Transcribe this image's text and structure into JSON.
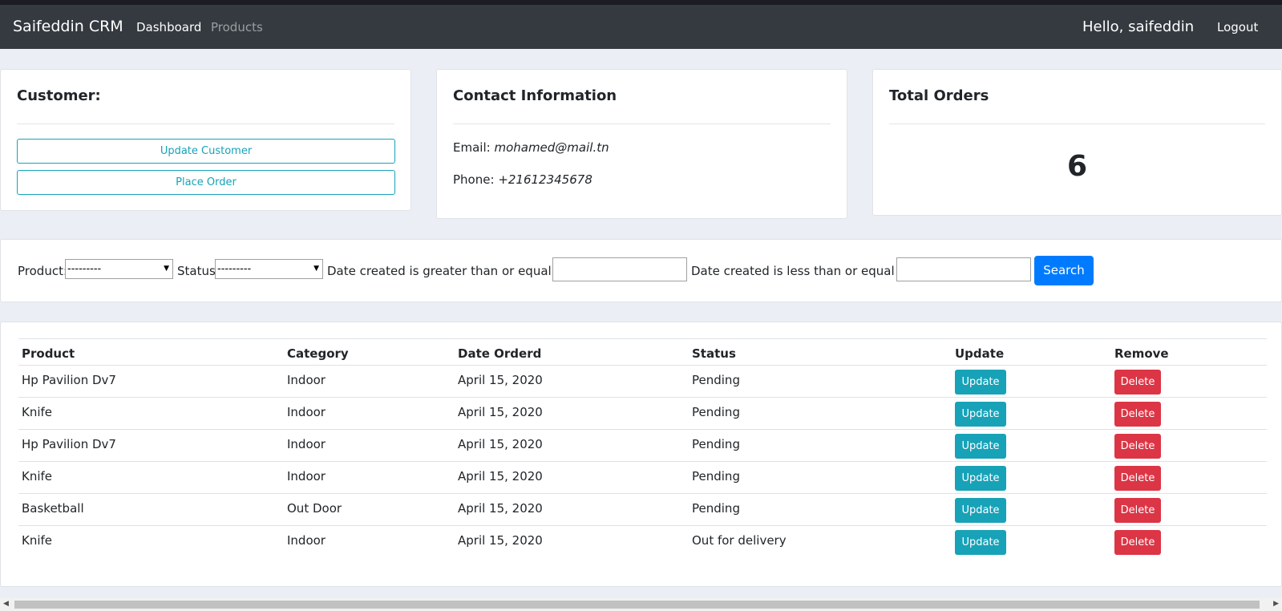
{
  "navbar": {
    "brand": "Saifeddin CRM",
    "links": [
      "Dashboard",
      "Products"
    ],
    "greeting": "Hello, saifeddin",
    "logout": "Logout"
  },
  "customer_card": {
    "title": "Customer:",
    "update_button": "Update Customer",
    "order_button": "Place Order"
  },
  "contact_card": {
    "title": "Contact Information",
    "email_label": "Email:",
    "email": "mohamed@mail.tn",
    "phone_label": "Phone:",
    "phone": "+21612345678"
  },
  "orders_card": {
    "title": "Total Orders",
    "count": "6"
  },
  "filter": {
    "product_label": "Product:",
    "product_value": "---------",
    "status_label": "Status:",
    "status_value": "---------",
    "date_gte_label": "Date created is greater than or equal to:",
    "date_lte_label": "Date created is less than or equal to:",
    "search_button": "Search"
  },
  "table": {
    "headers": [
      "Product",
      "Category",
      "Date Orderd",
      "Status",
      "Update",
      "Remove"
    ],
    "update_label": "Update",
    "delete_label": "Delete",
    "rows": [
      [
        "Hp Pavilion Dv7",
        "Indoor",
        "April 15, 2020",
        "Pending"
      ],
      [
        "Knife",
        "Indoor",
        "April 15, 2020",
        "Pending"
      ],
      [
        "Hp Pavilion Dv7",
        "Indoor",
        "April 15, 2020",
        "Pending"
      ],
      [
        "Knife",
        "Indoor",
        "April 15, 2020",
        "Pending"
      ],
      [
        "Basketball",
        "Out Door",
        "April 15, 2020",
        "Pending"
      ],
      [
        "Knife",
        "Indoor",
        "April 15, 2020",
        "Out for delivery"
      ]
    ]
  },
  "colors": {
    "navbar": "#343a40",
    "info": "#17a2b8",
    "primary": "#007bff",
    "danger": "#dc3545"
  }
}
